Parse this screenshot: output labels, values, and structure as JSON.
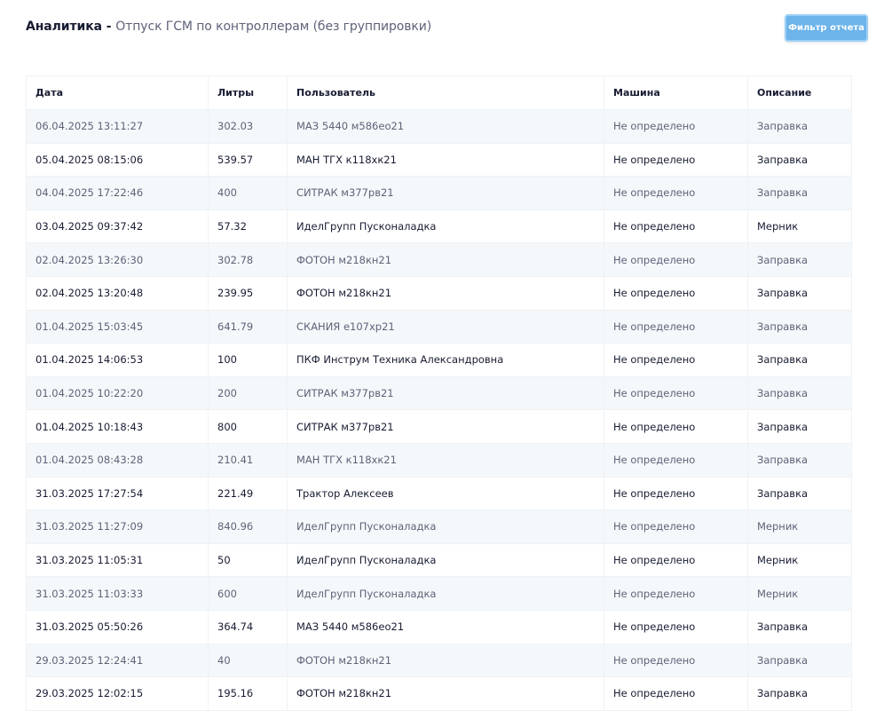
{
  "header": {
    "title_bold": "Аналитика -",
    "title_sub": "Отпуск ГСМ по контроллерам (без группировки)",
    "filter_button_label": "Фильтр отчета"
  },
  "colors": {
    "accent": "#6cb4ea",
    "row_stripe": "#f5f8fa",
    "text_primary": "#181c32",
    "text_muted": "#5e6278"
  },
  "table": {
    "headers": [
      "Дата",
      "Литры",
      "Пользователь",
      "Машина",
      "Описание"
    ],
    "rows": [
      [
        "06.04.2025 13:11:27",
        "302.03",
        "МАЗ 5440 м586ео21",
        "Не определено",
        "Заправка"
      ],
      [
        "05.04.2025 08:15:06",
        "539.57",
        "МАН ТГХ к118хк21",
        "Не определено",
        "Заправка"
      ],
      [
        "04.04.2025 17:22:46",
        "400",
        "СИТРАК м377рв21",
        "Не определено",
        "Заправка"
      ],
      [
        "03.04.2025 09:37:42",
        "57.32",
        "ИделГрупп Пусконаладка",
        "Не определено",
        "Мерник"
      ],
      [
        "02.04.2025 13:26:30",
        "302.78",
        "ФОТОН м218кн21",
        "Не определено",
        "Заправка"
      ],
      [
        "02.04.2025 13:20:48",
        "239.95",
        "ФОТОН м218кн21",
        "Не определено",
        "Заправка"
      ],
      [
        "01.04.2025 15:03:45",
        "641.79",
        "СКАНИЯ е107хр21",
        "Не определено",
        "Заправка"
      ],
      [
        "01.04.2025 14:06:53",
        "100",
        "ПКФ Инструм Техника Александровна",
        "Не определено",
        "Заправка"
      ],
      [
        "01.04.2025 10:22:20",
        "200",
        "СИТРАК м377рв21",
        "Не определено",
        "Заправка"
      ],
      [
        "01.04.2025 10:18:43",
        "800",
        "СИТРАК м377рв21",
        "Не определено",
        "Заправка"
      ],
      [
        "01.04.2025 08:43:28",
        "210.41",
        "МАН ТГХ к118хк21",
        "Не определено",
        "Заправка"
      ],
      [
        "31.03.2025 17:27:54",
        "221.49",
        "Трактор Алексеев",
        "Не определено",
        "Заправка"
      ],
      [
        "31.03.2025 11:27:09",
        "840.96",
        "ИделГрупп Пусконаладка",
        "Не определено",
        "Мерник"
      ],
      [
        "31.03.2025 11:05:31",
        "50",
        "ИделГрупп Пусконаладка",
        "Не определено",
        "Мерник"
      ],
      [
        "31.03.2025 11:03:33",
        "600",
        "ИделГрупп Пусконаладка",
        "Не определено",
        "Мерник"
      ],
      [
        "31.03.2025 05:50:26",
        "364.74",
        "МАЗ 5440 м586ео21",
        "Не определено",
        "Заправка"
      ],
      [
        "29.03.2025 12:24:41",
        "40",
        "ФОТОН м218кн21",
        "Не определено",
        "Заправка"
      ],
      [
        "29.03.2025 12:02:15",
        "195.16",
        "ФОТОН м218кн21",
        "Не определено",
        "Заправка"
      ]
    ]
  }
}
